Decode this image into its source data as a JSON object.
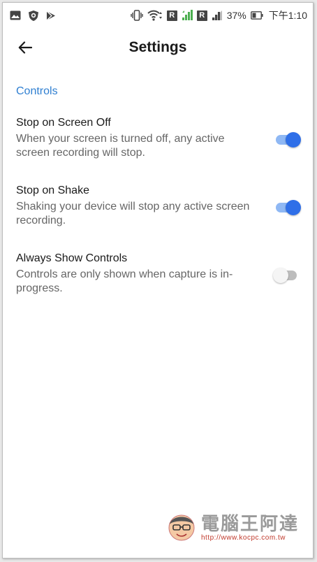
{
  "status_bar": {
    "battery_percent": "37%",
    "time": "下午1:10",
    "badge_r": "R",
    "icons": [
      "image-icon",
      "shield-icon",
      "play-store-icon",
      "vibrate-icon",
      "wifi-icon",
      "signal-icon",
      "battery-icon"
    ]
  },
  "app_bar": {
    "title": "Settings",
    "back_icon": "arrow-left-icon"
  },
  "section": {
    "title": "Controls"
  },
  "settings": [
    {
      "title": "Stop on Screen Off",
      "summary": "When your screen is turned off, any active screen recording will stop.",
      "enabled": true
    },
    {
      "title": "Stop on Shake",
      "summary": "Shaking your device will stop any active screen recording.",
      "enabled": true
    },
    {
      "title": "Always Show Controls",
      "summary": "Controls are only shown when capture is in-progress.",
      "enabled": false
    }
  ],
  "colors": {
    "accent": "#2f7fd1",
    "toggle_on_thumb": "#2f6fe8",
    "toggle_on_track": "#8fb8f4",
    "toggle_off_thumb": "#f5f5f5",
    "toggle_off_track": "#bdbdbd"
  },
  "watermark": {
    "text": "電腦王阿達",
    "url": "http://www.kocpc.com.tw"
  }
}
